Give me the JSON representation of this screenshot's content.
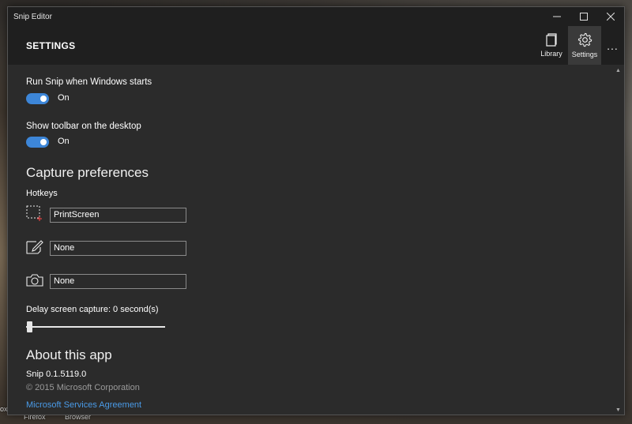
{
  "window": {
    "title": "Snip Editor"
  },
  "appbar": {
    "page_title": "SETTINGS",
    "tabs": [
      {
        "label": "Library",
        "icon": "library-icon"
      },
      {
        "label": "Settings",
        "icon": "gear-icon"
      }
    ],
    "more_label": "..."
  },
  "settings": {
    "run_on_start": {
      "label": "Run Snip when Windows starts",
      "state": "On"
    },
    "show_toolbar": {
      "label": "Show toolbar on the desktop",
      "state": "On"
    }
  },
  "capture": {
    "heading": "Capture preferences",
    "hotkeys_label": "Hotkeys",
    "hotkeys": [
      {
        "icon": "region-capture-icon",
        "value": "PrintScreen"
      },
      {
        "icon": "whiteboard-icon",
        "value": "None"
      },
      {
        "icon": "camera-icon",
        "value": "None"
      }
    ],
    "delay_label": "Delay screen capture: 0 second(s)",
    "delay_value": 0
  },
  "about": {
    "heading": "About this app",
    "version": "Snip 0.1.5119.0",
    "copyright": "© 2015 Microsoft Corporation",
    "agreement_link": "Microsoft Services Agreement"
  },
  "desktop": {
    "labels": [
      "Firefox",
      "Browser",
      "ox"
    ]
  },
  "colors": {
    "accent": "#3d86d8",
    "link": "#4a9be8"
  }
}
